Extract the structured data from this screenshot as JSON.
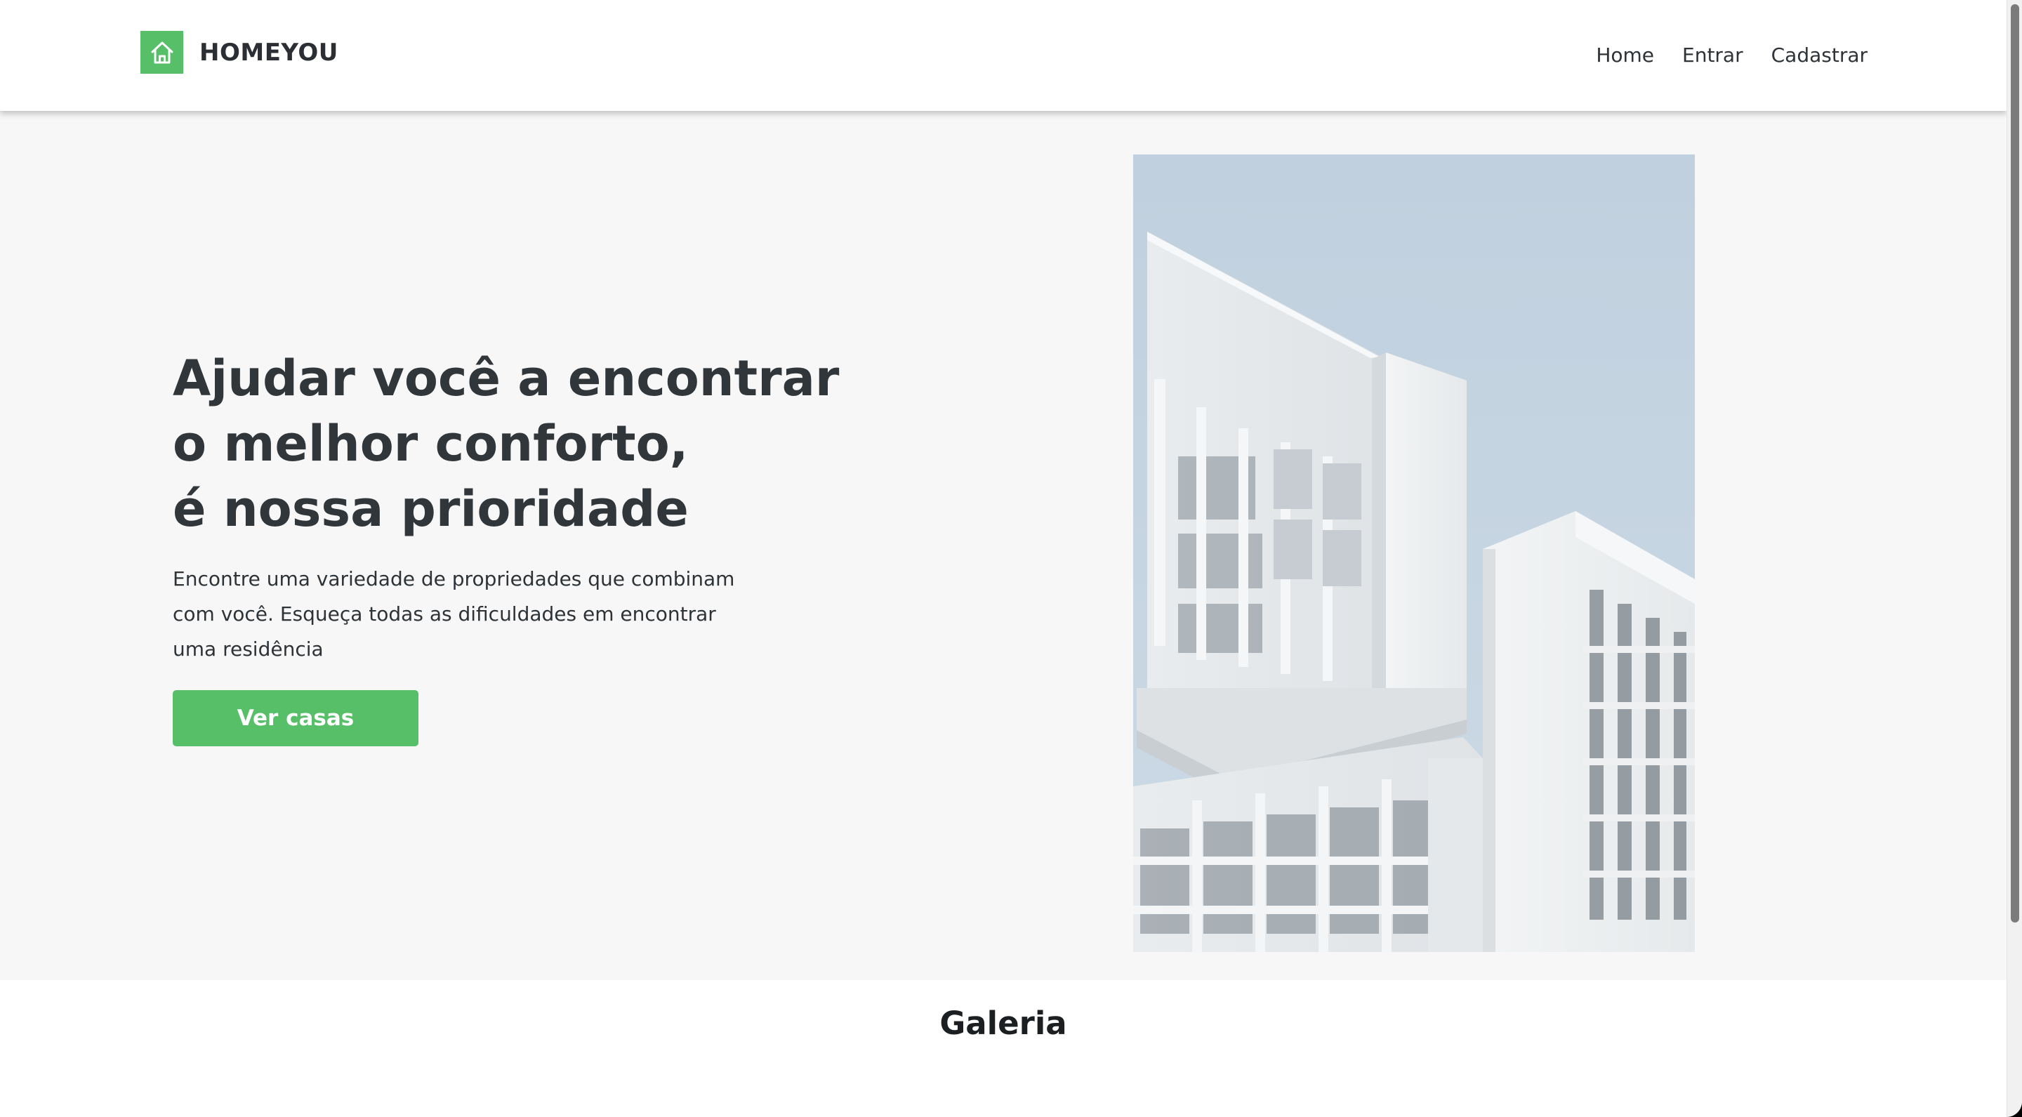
{
  "header": {
    "brand": "HOMEYOU",
    "logo_icon": "house-icon",
    "brand_color": "#56bf68",
    "nav": [
      {
        "label": "Home"
      },
      {
        "label": "Entrar"
      },
      {
        "label": "Cadastrar"
      }
    ]
  },
  "hero": {
    "headline_lines": [
      "Ajudar você a encontrar",
      "o melhor conforto,",
      "é nossa prioridade"
    ],
    "subtext": "Encontre uma variedade de propriedades que combinam com você. Esqueça todas as dificuldades em encontrar uma residência",
    "cta_label": "Ver casas",
    "image": "white-modern-building-photo"
  },
  "gallery": {
    "title": "Galeria"
  }
}
